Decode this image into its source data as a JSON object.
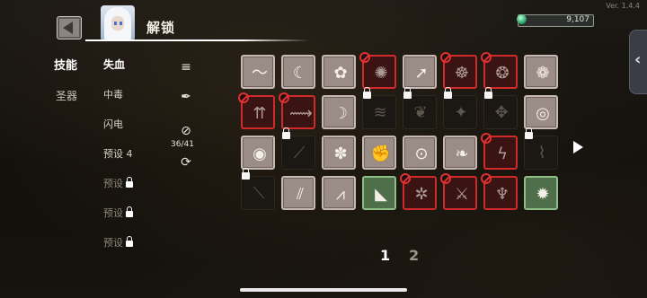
{
  "version": "Ver. 1.4.4",
  "header": {
    "title": "解锁",
    "currency_value": "9,107"
  },
  "categories": [
    {
      "label": "技能",
      "active": true
    },
    {
      "label": "圣器",
      "active": false
    }
  ],
  "presets": [
    {
      "label": "失血",
      "state": "selected"
    },
    {
      "label": "中毒",
      "state": "normal"
    },
    {
      "label": "闪电",
      "state": "normal"
    },
    {
      "label": "预设 4",
      "state": "normal"
    },
    {
      "label": "预设",
      "state": "locked"
    },
    {
      "label": "预设",
      "state": "locked"
    },
    {
      "label": "预设",
      "state": "locked"
    }
  ],
  "tools": {
    "sort_icon": "sort-icon",
    "brush_icon": "quill-icon",
    "forbid_icon": "forbid-icon",
    "counter": "36/41",
    "refresh_icon": "refresh-icon"
  },
  "grid": {
    "rows": [
      [
        {
          "status": "normal",
          "icon": "slash-swirl",
          "glyph": "〜"
        },
        {
          "status": "normal",
          "icon": "blade-arc",
          "glyph": "☾"
        },
        {
          "status": "normal",
          "icon": "burst-leaf",
          "glyph": "✿"
        },
        {
          "status": "banned",
          "icon": "star-burst",
          "glyph": "✺"
        },
        {
          "status": "normal",
          "icon": "arrow-strike",
          "glyph": "➚"
        },
        {
          "status": "banned",
          "icon": "dagger-ring",
          "glyph": "☸"
        },
        {
          "status": "banned",
          "icon": "bomb-orb",
          "glyph": "❂"
        },
        {
          "status": "normal",
          "icon": "thorn-ring",
          "glyph": "❁"
        }
      ],
      [
        {
          "status": "banned",
          "icon": "triple-arrow",
          "glyph": "⇈"
        },
        {
          "status": "banned",
          "icon": "fish-spear",
          "glyph": "⟿"
        },
        {
          "status": "normal",
          "icon": "crescent-claw",
          "glyph": "☽"
        },
        {
          "status": "locked",
          "icon": "wave-slash",
          "glyph": "≋"
        },
        {
          "status": "locked",
          "icon": "feather",
          "glyph": "❦"
        },
        {
          "status": "locked",
          "icon": "cross-spark",
          "glyph": "✦"
        },
        {
          "status": "locked",
          "icon": "leaf-cross",
          "glyph": "✥"
        },
        {
          "status": "normal",
          "icon": "spiral",
          "glyph": "◎"
        }
      ],
      [
        {
          "status": "normal",
          "icon": "target-orb",
          "glyph": "◉"
        },
        {
          "status": "locked",
          "icon": "sword-slash",
          "glyph": "⟋"
        },
        {
          "status": "normal",
          "icon": "chain-burst",
          "glyph": "✽"
        },
        {
          "status": "normal",
          "icon": "fist-strike",
          "glyph": "✊"
        },
        {
          "status": "normal",
          "icon": "whirl-ring",
          "glyph": "⊙"
        },
        {
          "status": "normal",
          "icon": "leaf-blade",
          "glyph": "❧"
        },
        {
          "status": "banned",
          "icon": "lightning-orb",
          "glyph": "ϟ"
        },
        {
          "status": "locked",
          "icon": "scythe",
          "glyph": "⌇"
        }
      ],
      [
        {
          "status": "locked",
          "icon": "bone-rod",
          "glyph": "⟍"
        },
        {
          "status": "normal",
          "icon": "double-slash",
          "glyph": "⫽"
        },
        {
          "status": "normal",
          "icon": "zigzag-spike",
          "glyph": "⩘"
        },
        {
          "status": "selected",
          "icon": "shard-burst",
          "glyph": "◣"
        },
        {
          "status": "banned",
          "icon": "thorn-chain",
          "glyph": "✲"
        },
        {
          "status": "banned",
          "icon": "slash-spark",
          "glyph": "⚔"
        },
        {
          "status": "banned",
          "icon": "root-hand",
          "glyph": "♆"
        },
        {
          "status": "selected",
          "icon": "flame-orb",
          "glyph": "✹"
        }
      ]
    ]
  },
  "pagination": {
    "pages": [
      "1",
      "2"
    ],
    "current": "1"
  },
  "colors": {
    "accent_red": "#d12a2a",
    "selected_green": "#8ebd86",
    "currency_gem": "#2fa36b"
  }
}
